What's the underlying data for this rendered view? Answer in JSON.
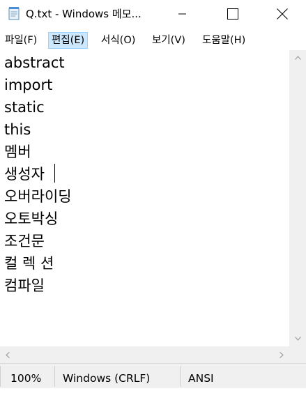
{
  "window": {
    "title": "Q.txt - Windows 메모...",
    "icon": "notepad-icon",
    "controls": [
      "minimize-icon",
      "maximize-icon",
      "close-icon"
    ]
  },
  "menu": {
    "items": [
      {
        "label": "파일(F)"
      },
      {
        "label": "편집(E)",
        "active": true
      },
      {
        "label": "서식(O)"
      },
      {
        "label": "보기(V)"
      },
      {
        "label": "도움말(H)"
      }
    ]
  },
  "editor": {
    "lines": [
      "abstract",
      "import",
      "static",
      "this",
      "멤버",
      "생성자",
      "오버라이딩",
      "오토박싱",
      "조건문",
      "컬 렉 션",
      "컴파일"
    ],
    "caret_line": 6
  },
  "status": {
    "zoom": "100%",
    "line_ending": "Windows (CRLF)",
    "encoding": "ANSI"
  },
  "colors": {
    "menu_active_bg": "#cce8ff",
    "menu_active_border": "#99d1ff",
    "statusbar_bg": "#f0f0f0"
  }
}
